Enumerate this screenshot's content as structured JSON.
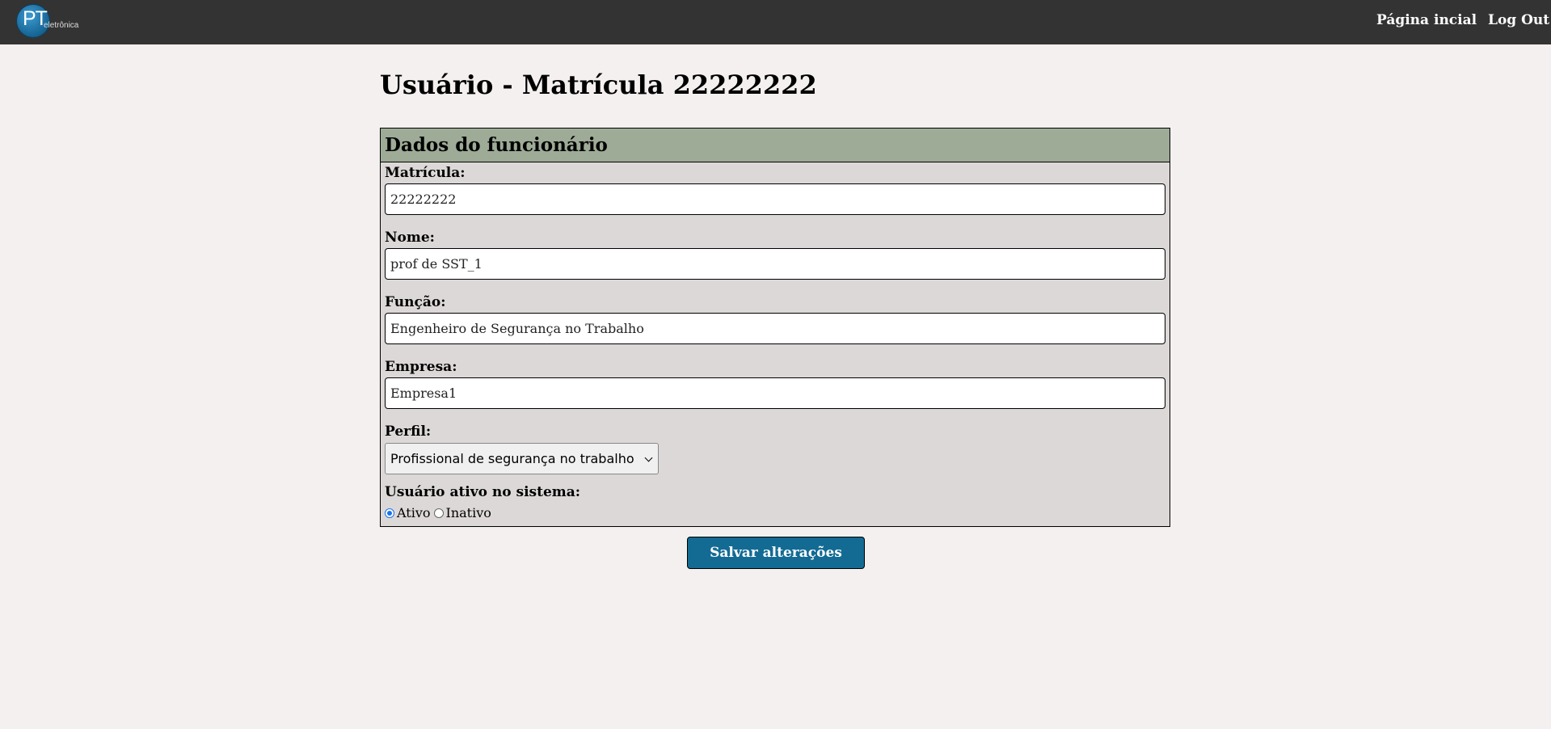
{
  "header": {
    "logo_main": "PT",
    "logo_sub": "eletrônica",
    "nav": {
      "home": "Página incial",
      "logout": "Log Out"
    },
    "colors": {
      "bar": "#333333",
      "logo": "#1a6b9b"
    }
  },
  "page": {
    "title": "Usuário - Matrícula 22222222"
  },
  "panel": {
    "title": "Dados do funcionário",
    "header_color": "#9eab97",
    "fields": {
      "matricula": {
        "label": "Matrícula:",
        "value": "22222222"
      },
      "nome": {
        "label": "Nome:",
        "value": "prof de SST_1"
      },
      "funcao": {
        "label": "Função:",
        "value": "Engenheiro de Segurança no Trabalho"
      },
      "empresa": {
        "label": "Empresa:",
        "value": "Empresa1"
      }
    },
    "perfil": {
      "label": "Perfil:",
      "selected": "Profissional de segurança no trabalho",
      "icon": "chevron-down-icon"
    },
    "status": {
      "label": "Usuário ativo no sistema:",
      "options": [
        "Ativo",
        "Inativo"
      ],
      "selected": "Ativo"
    }
  },
  "actions": {
    "save_label": "Salvar alterações",
    "save_color": "#136b94"
  }
}
